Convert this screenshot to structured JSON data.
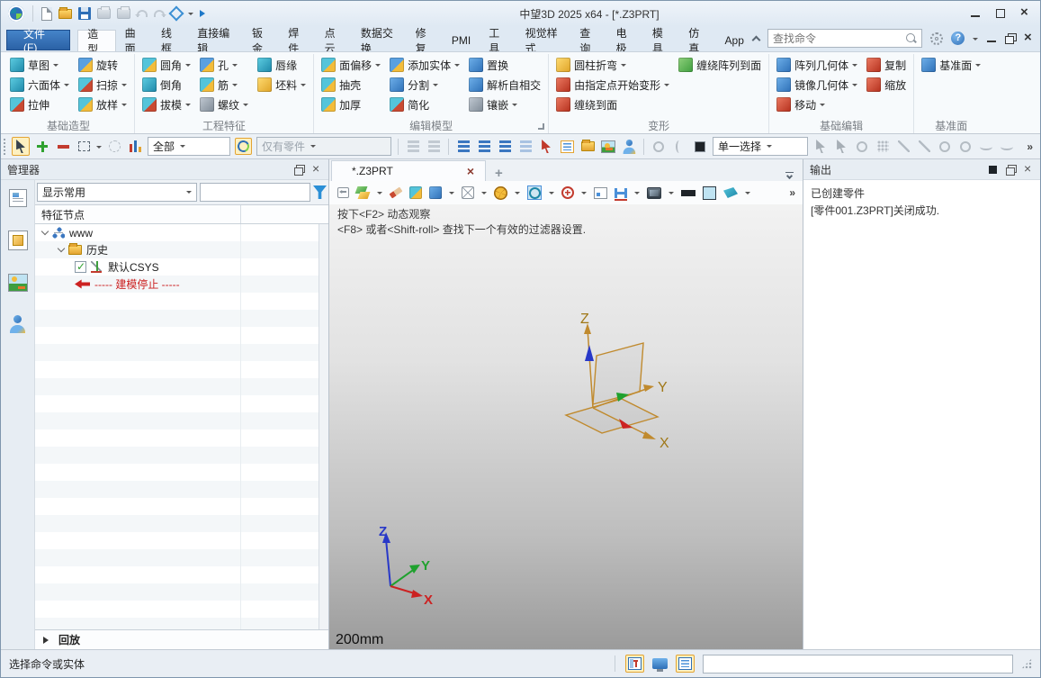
{
  "window": {
    "title": "中望3D 2025 x64 - [*.Z3PRT]"
  },
  "quick_access": {
    "icons": [
      "zw3d-logo",
      "new-file",
      "open-file",
      "save",
      "print",
      "print-convert",
      "undo",
      "redo",
      "regen",
      "quick-access-dropdown",
      "start"
    ]
  },
  "menu": {
    "file": "文件(F)",
    "tabs": [
      "造型",
      "曲面",
      "线框",
      "直接编辑",
      "钣金",
      "焊件",
      "点云",
      "数据交换",
      "修复",
      "PMI",
      "工具",
      "视觉样式",
      "查询",
      "电极",
      "模具",
      "仿真",
      "App"
    ],
    "active_tab": "造型",
    "search_placeholder": "查找命令"
  },
  "ribbon": {
    "groups": [
      {
        "label": "基础造型",
        "cols": [
          [
            {
              "label": "草图",
              "dd": true
            },
            {
              "label": "六面体",
              "dd": true
            },
            {
              "label": "拉伸",
              "dd": false
            }
          ],
          [
            {
              "label": "旋转",
              "dd": false
            },
            {
              "label": "扫掠",
              "dd": true
            },
            {
              "label": "放样",
              "dd": true
            }
          ]
        ]
      },
      {
        "label": "工程特征",
        "cols": [
          [
            {
              "label": "圆角",
              "dd": true
            },
            {
              "label": "倒角",
              "dd": false
            },
            {
              "label": "拔模",
              "dd": true
            }
          ],
          [
            {
              "label": "孔",
              "dd": true
            },
            {
              "label": "筋",
              "dd": true
            },
            {
              "label": "螺纹",
              "dd": true
            }
          ],
          [
            {
              "label": "唇缘",
              "dd": false
            },
            {
              "label": "坯料",
              "dd": true
            }
          ]
        ]
      },
      {
        "label": "编辑模型",
        "cols": [
          [
            {
              "label": "面偏移",
              "dd": true
            },
            {
              "label": "抽壳",
              "dd": false
            },
            {
              "label": "加厚",
              "dd": false
            }
          ],
          [
            {
              "label": "添加实体",
              "dd": true
            },
            {
              "label": "分割",
              "dd": true
            },
            {
              "label": "简化",
              "dd": false
            }
          ],
          [
            {
              "label": "置换",
              "dd": false
            },
            {
              "label": "解析自相交",
              "dd": false
            },
            {
              "label": "镶嵌",
              "dd": true
            }
          ]
        ]
      },
      {
        "label": "变形",
        "cols": [
          [
            {
              "label": "圆柱折弯",
              "dd": true
            },
            {
              "label": "由指定点开始变形",
              "dd": true
            },
            {
              "label": "缠绕到面",
              "dd": false
            }
          ],
          [
            {
              "label": "缠绕阵列到面",
              "dd": false
            }
          ]
        ]
      },
      {
        "label": "基础编辑",
        "cols": [
          [
            {
              "label": "阵列几何体",
              "dd": true
            },
            {
              "label": "镜像几何体",
              "dd": true
            },
            {
              "label": "移动",
              "dd": true
            }
          ],
          [
            {
              "label": "复制",
              "dd": false
            },
            {
              "label": "缩放",
              "dd": false
            }
          ]
        ]
      },
      {
        "label": "基准面",
        "cols": [
          [
            {
              "label": "基准面",
              "dd": true
            }
          ]
        ]
      }
    ]
  },
  "doc_toolbar": {
    "filter_all": "全部",
    "entity_filter": "仅有零件",
    "selection_mode": "单一选择"
  },
  "manager": {
    "title": "管理器",
    "show_mode": "显示常用",
    "column_header": "特征节点",
    "tree": {
      "root": "www",
      "history": "历史",
      "csys": "默认CSYS",
      "stop_marker": "----- 建模停止 -----"
    },
    "playback": "回放"
  },
  "document": {
    "tab_title": "*.Z3PRT",
    "hint_line1": "按下<F2> 动态观察",
    "hint_line2": "<F8> 或者<Shift-roll> 查找下一个有效的过滤器设置.",
    "scale_label": "200mm",
    "axes": {
      "x": "X",
      "y": "Y",
      "z": "Z"
    }
  },
  "output": {
    "title": "输出",
    "lines": [
      "已创建零件",
      "[零件001.Z3PRT]关闭成功."
    ]
  },
  "status": {
    "message": "选择命令或实体"
  },
  "colors": {
    "accent_blue": "#2E6FB7",
    "highlight_yellow": "#FDF0C0",
    "highlight_border": "#E3A433",
    "stop_red": "#CC2222",
    "axis_tan": "#C08A2E",
    "axis_blue": "#2838C8",
    "axis_green": "#1FA12E",
    "axis_red": "#CC2222"
  }
}
